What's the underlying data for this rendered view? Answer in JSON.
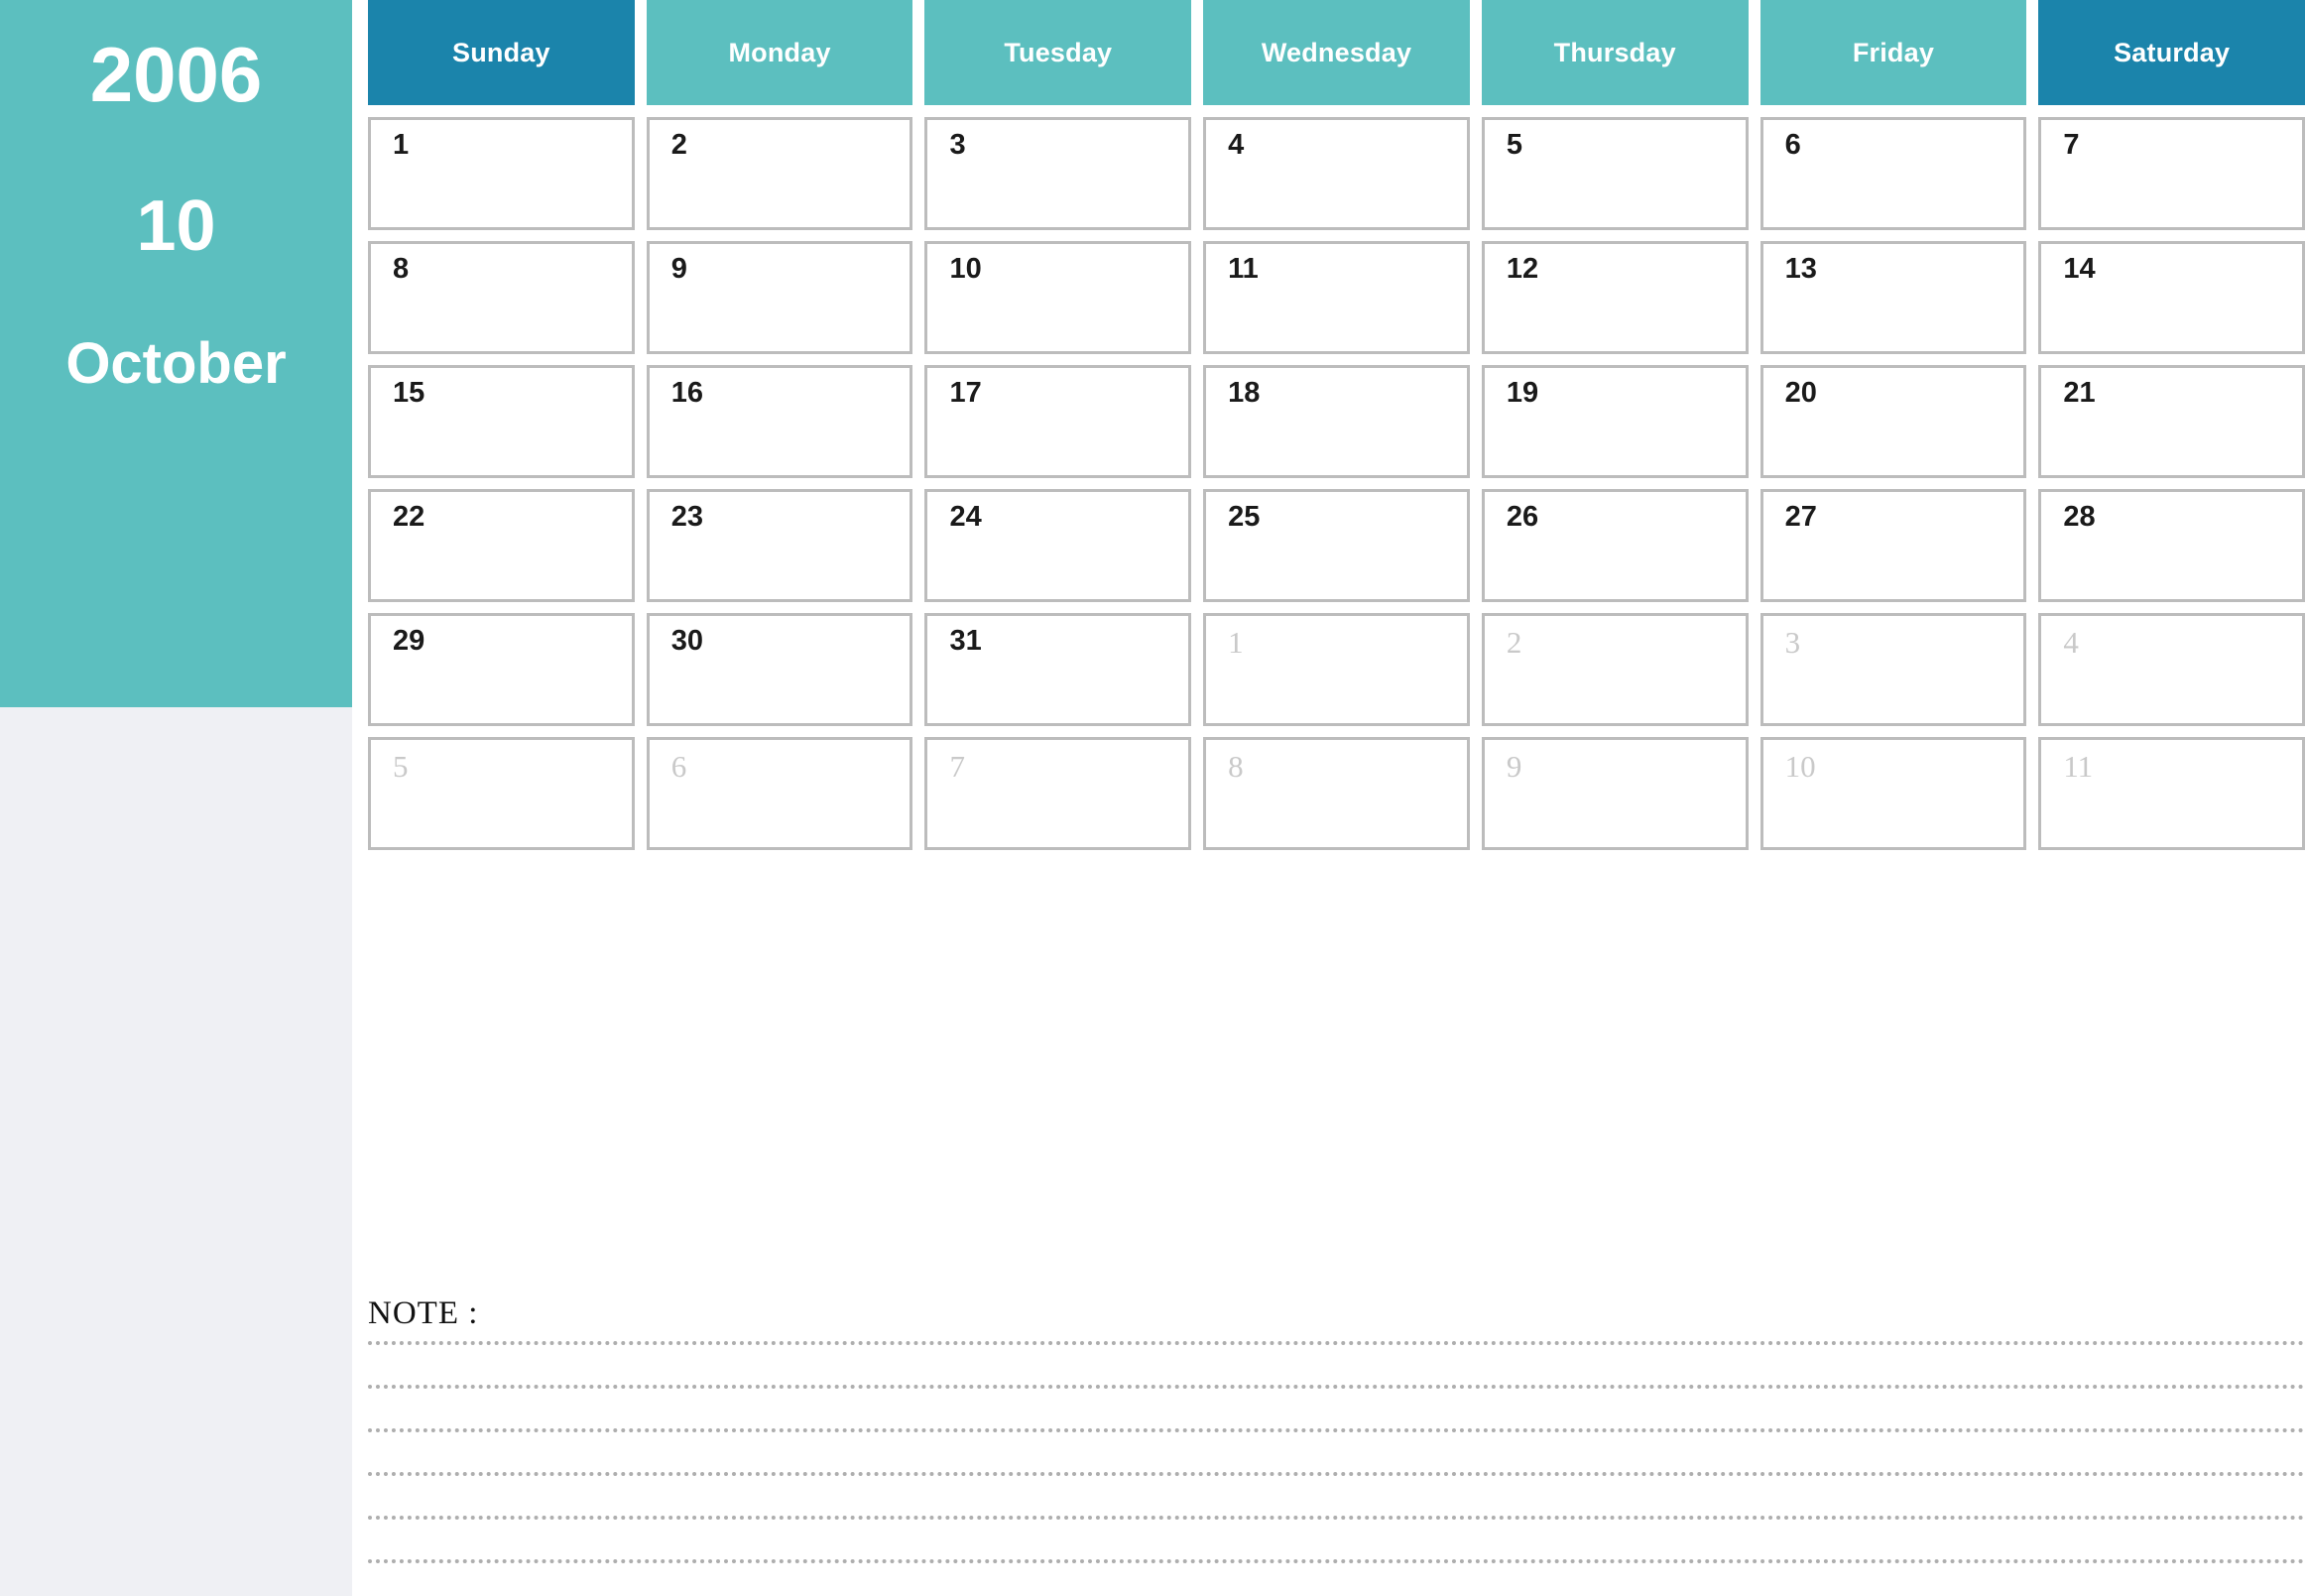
{
  "sidebar": {
    "year": "2006",
    "month_number": "10",
    "month_name": "October",
    "background_color": "#5cbfbf",
    "panel_color": "#eff0f4"
  },
  "header": {
    "weekend_color": "#1b84ab",
    "weekday_color": "#5cbfbf",
    "days": [
      {
        "label": "Sunday",
        "weekend": true
      },
      {
        "label": "Monday",
        "weekend": false
      },
      {
        "label": "Tuesday",
        "weekend": false
      },
      {
        "label": "Wednesday",
        "weekend": false
      },
      {
        "label": "Thursday",
        "weekend": false
      },
      {
        "label": "Friday",
        "weekend": false
      },
      {
        "label": "Saturday",
        "weekend": true
      }
    ]
  },
  "grid": {
    "weeks": [
      [
        {
          "num": "1",
          "current": true
        },
        {
          "num": "2",
          "current": true
        },
        {
          "num": "3",
          "current": true
        },
        {
          "num": "4",
          "current": true
        },
        {
          "num": "5",
          "current": true
        },
        {
          "num": "6",
          "current": true
        },
        {
          "num": "7",
          "current": true
        }
      ],
      [
        {
          "num": "8",
          "current": true
        },
        {
          "num": "9",
          "current": true
        },
        {
          "num": "10",
          "current": true
        },
        {
          "num": "11",
          "current": true
        },
        {
          "num": "12",
          "current": true
        },
        {
          "num": "13",
          "current": true
        },
        {
          "num": "14",
          "current": true
        }
      ],
      [
        {
          "num": "15",
          "current": true
        },
        {
          "num": "16",
          "current": true
        },
        {
          "num": "17",
          "current": true
        },
        {
          "num": "18",
          "current": true
        },
        {
          "num": "19",
          "current": true
        },
        {
          "num": "20",
          "current": true
        },
        {
          "num": "21",
          "current": true
        }
      ],
      [
        {
          "num": "22",
          "current": true
        },
        {
          "num": "23",
          "current": true
        },
        {
          "num": "24",
          "current": true
        },
        {
          "num": "25",
          "current": true
        },
        {
          "num": "26",
          "current": true
        },
        {
          "num": "27",
          "current": true
        },
        {
          "num": "28",
          "current": true
        }
      ],
      [
        {
          "num": "29",
          "current": true
        },
        {
          "num": "30",
          "current": true
        },
        {
          "num": "31",
          "current": true
        },
        {
          "num": "1",
          "current": false
        },
        {
          "num": "2",
          "current": false
        },
        {
          "num": "3",
          "current": false
        },
        {
          "num": "4",
          "current": false
        }
      ],
      [
        {
          "num": "5",
          "current": false
        },
        {
          "num": "6",
          "current": false
        },
        {
          "num": "7",
          "current": false
        },
        {
          "num": "8",
          "current": false
        },
        {
          "num": "9",
          "current": false
        },
        {
          "num": "10",
          "current": false
        },
        {
          "num": "11",
          "current": false
        }
      ]
    ]
  },
  "note": {
    "label": "NOTE :",
    "line_count": 6
  }
}
